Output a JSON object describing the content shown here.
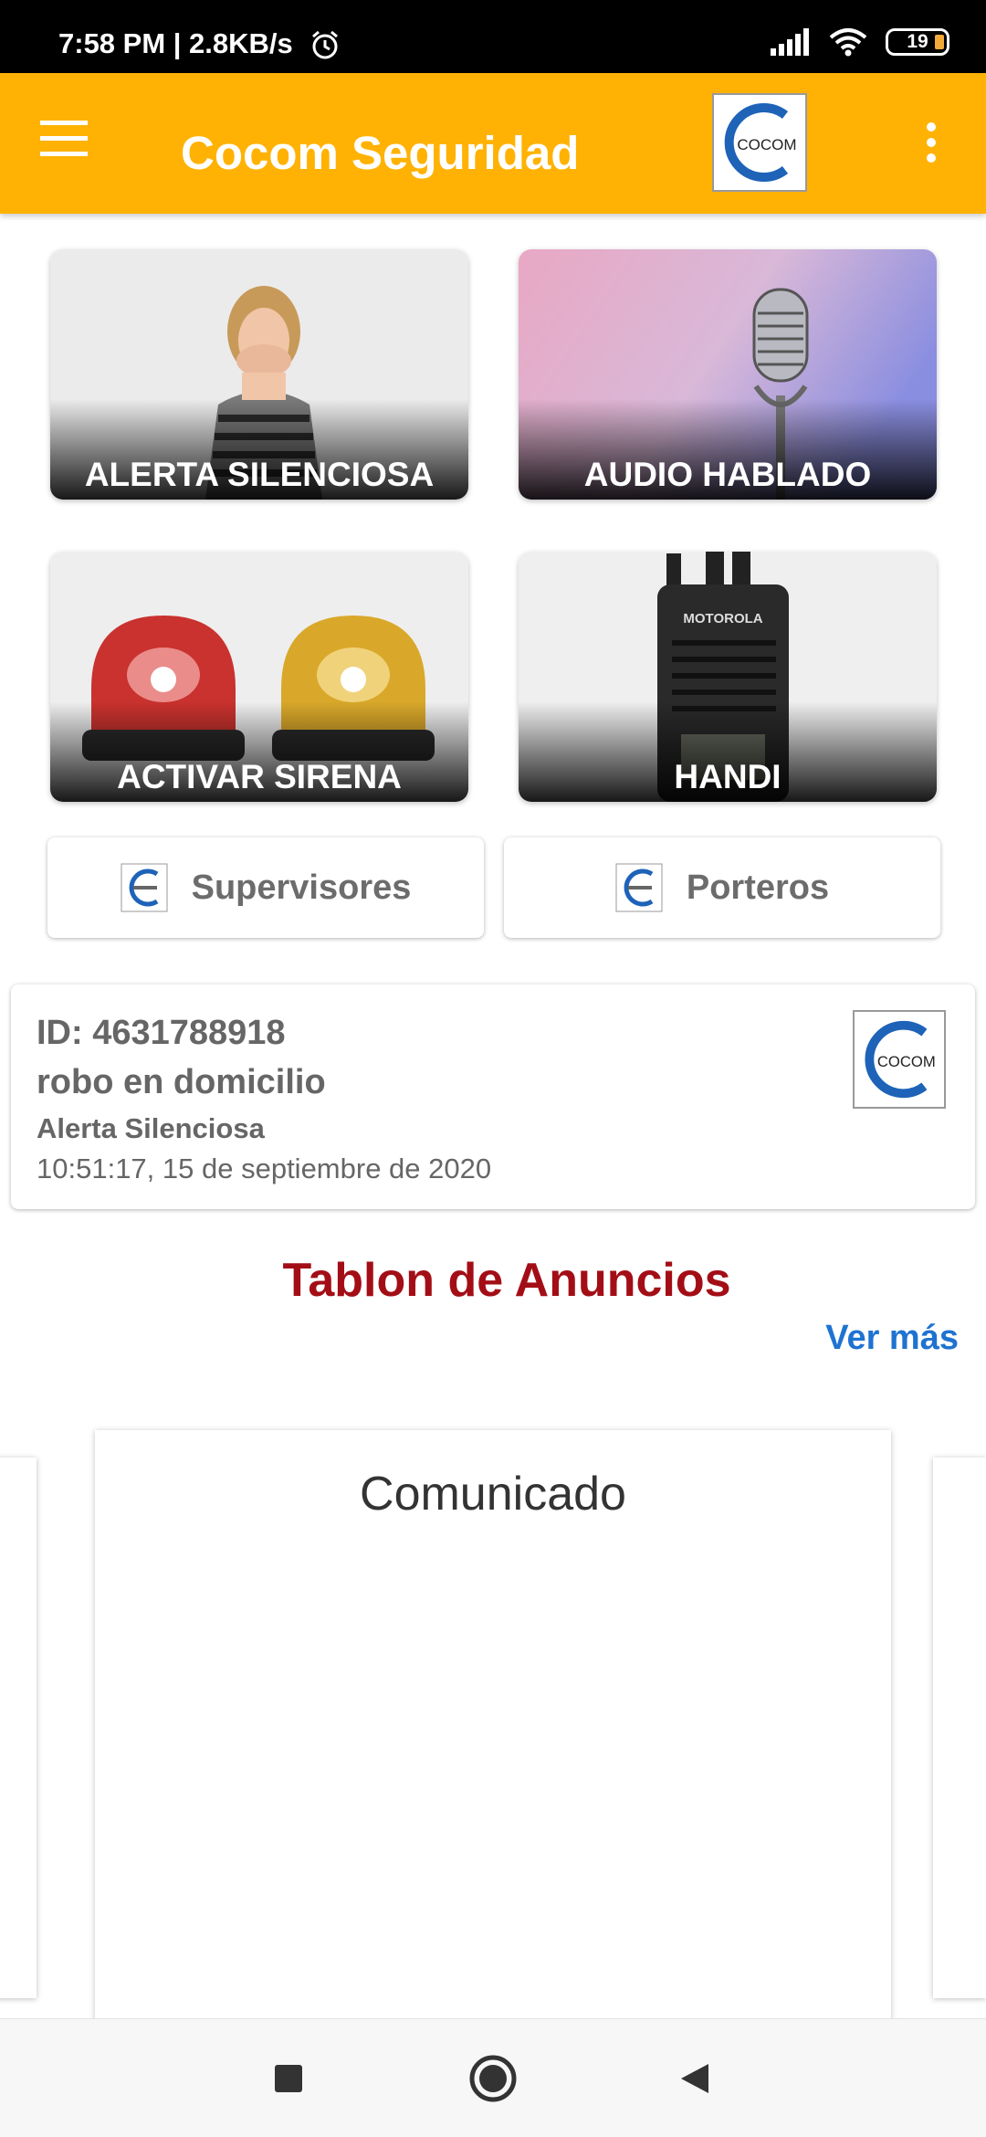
{
  "status_bar": {
    "time": "7:58 PM | 2.8KB/s",
    "battery": "19"
  },
  "app_bar": {
    "title": "Cocom Seguridad",
    "logo_text": "COCOM"
  },
  "tiles": [
    {
      "label": "ALERTA SILENCIOSA"
    },
    {
      "label": "AUDIO HABLADO"
    },
    {
      "label": "ACTIVAR SIRENA"
    },
    {
      "label": "HANDI"
    }
  ],
  "handi_brand": "MOTOROLA",
  "buttons": {
    "supervisors": "Supervisores",
    "doormen": "Porteros"
  },
  "alert": {
    "id": "ID: 4631788918",
    "description": "robo en domicilio",
    "type": "Alerta Silenciosa",
    "timestamp": "10:51:17, 15 de septiembre de 2020"
  },
  "board": {
    "title": "Tablon de Anuncios",
    "see_more": "Ver más",
    "card_title": "Comunicado"
  },
  "colors": {
    "accent": "#ffb203",
    "title_red": "#a30e16",
    "link_blue": "#1e73d1",
    "logo_blue": "#1e63b8"
  }
}
